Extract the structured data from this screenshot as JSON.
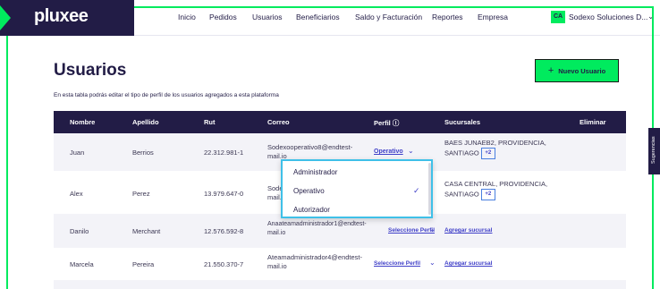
{
  "brand": {
    "logo": "pluxee",
    "primary": "#221c46",
    "accent": "#00eb5e",
    "link": "#4040c8"
  },
  "nav": {
    "items": [
      "Inicio",
      "Pedidos",
      "Usuarios",
      "Beneficiarios",
      "Saldo y Facturación",
      "Reportes",
      "Empresa"
    ],
    "company_badge": "CA",
    "company_name": "Sodexo Soluciones D...",
    "chevron_icon": "chevron-down-icon"
  },
  "page": {
    "title": "Usuarios",
    "subtitle": "En esta tabla podrás editar el tipo de perfil de los usuarios agregados a esta plataforma",
    "new_user_plus": "+",
    "new_user_label": "Nuevo Usuario"
  },
  "table": {
    "headers": {
      "nombre": "Nombre",
      "apellido": "Apellido",
      "rut": "Rut",
      "correo": "Correo",
      "perfil": "Perfil",
      "perfil_icon": "ⓘ",
      "sucursales": "Sucursales",
      "eliminar": "Eliminar"
    },
    "rows": [
      {
        "nombre": "Juan",
        "apellido": "Berrios",
        "rut": "22.312.981-1",
        "correo_1": "Sodexooperativo8@endtest-",
        "correo_2": "mail.io",
        "perfil": "Operativo",
        "sucursal_1": "BAES JUNAEB2, PROVIDENCIA,",
        "sucursal_2": "SANTIAGO",
        "extra": "+2"
      },
      {
        "nombre": "Alex",
        "apellido": "Perez",
        "rut": "13.979.647-0",
        "correo_1": "Sode",
        "correo_2": "mail.",
        "perfil": "",
        "sucursal_1": "CASA CENTRAL, PROVIDENCIA,",
        "sucursal_2": "SANTIAGO",
        "extra": "+2"
      },
      {
        "nombre": "Danilo",
        "apellido": "Merchant",
        "rut": "12.576.592-8",
        "correo_1": "Anaateamadministrador1@endtest-",
        "correo_2": "mail.io",
        "perfil": "Seleccione Perfil",
        "sucursal_link": "Agregar sucursal"
      },
      {
        "nombre": "Marcela",
        "apellido": "Pereira",
        "rut": "21.550.370-7",
        "correo_1": "Ateamadministrador4@endtest-",
        "correo_2": "mail.io",
        "perfil": "Seleccione Perfil",
        "sucursal_link": "Agregar sucursal"
      }
    ]
  },
  "dropdown": {
    "options": [
      "Administrador",
      "Operativo",
      "Autorizador"
    ],
    "selected": "Operativo",
    "check": "✓"
  },
  "side_tab": {
    "label": "Sugerencias"
  }
}
